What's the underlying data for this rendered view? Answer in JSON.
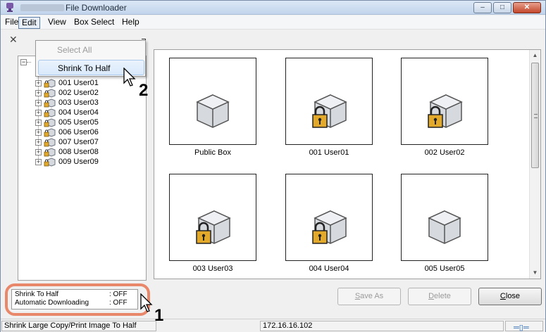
{
  "window": {
    "title": "File Downloader",
    "controls": [
      "–",
      "□",
      "✕"
    ]
  },
  "menu": {
    "items": [
      "File",
      "Edit",
      "View",
      "Box Select",
      "Help"
    ],
    "active": "Edit"
  },
  "edit_menu": {
    "items": [
      {
        "label": "Select All",
        "enabled": false
      },
      {
        "label": "Shrink To Half",
        "enabled": true,
        "highlighted": true
      }
    ]
  },
  "tree": {
    "items": [
      "001 User01",
      "002 User02",
      "003 User03",
      "004 User04",
      "005 User05",
      "006 User06",
      "007 User07",
      "008 User08",
      "009 User09"
    ]
  },
  "boxes": [
    {
      "label": "Public Box",
      "locked": false
    },
    {
      "label": "001 User01",
      "locked": true
    },
    {
      "label": "002 User02",
      "locked": true
    },
    {
      "label": "003 User03",
      "locked": true
    },
    {
      "label": "004 User04",
      "locked": true
    },
    {
      "label": "005 User05",
      "locked": false
    }
  ],
  "settings": {
    "shrink_label": "Shrink To Half",
    "shrink_value": ": OFF",
    "auto_label": "Automatic Downloading",
    "auto_value": ": OFF"
  },
  "buttons": {
    "save_as": {
      "pre": "",
      "u": "S",
      "post": "ave As"
    },
    "delete": {
      "pre": "",
      "u": "D",
      "post": "elete"
    },
    "close": {
      "pre": "",
      "u": "C",
      "post": "lose"
    }
  },
  "statusbar": {
    "message": "Shrink Large Copy/Print Image To Half",
    "ip": "172.16.16.102"
  },
  "steps": [
    "1",
    "2"
  ],
  "colors": {
    "highlight": "#e8876a",
    "lock": "#e2a92a",
    "cube": "#d6d9de"
  }
}
